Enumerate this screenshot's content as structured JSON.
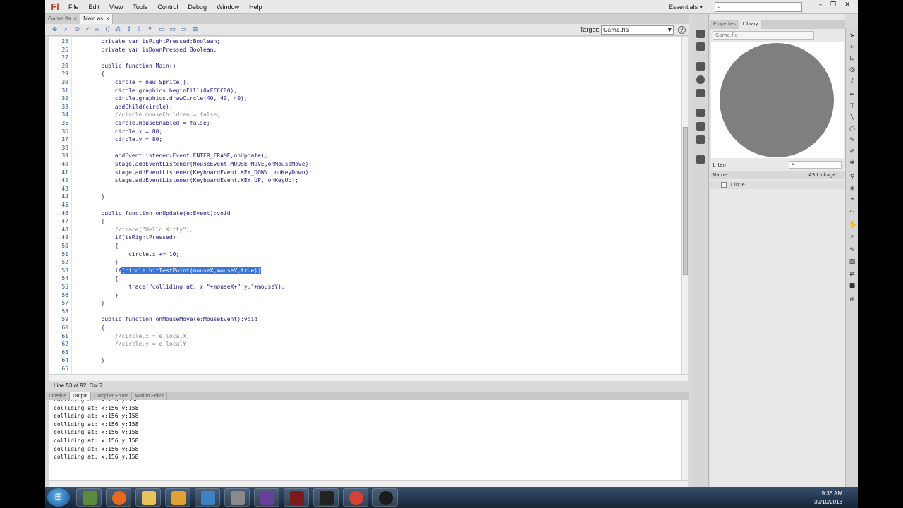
{
  "app": {
    "logo": "Fl"
  },
  "menu": [
    "File",
    "Edit",
    "View",
    "Tools",
    "Control",
    "Debug",
    "Window",
    "Help"
  ],
  "workspace": {
    "label": "Essentials ▾"
  },
  "tabs": [
    {
      "label": "Game.fla",
      "close": "×"
    },
    {
      "label": "Main.as",
      "close": "×"
    }
  ],
  "target": {
    "label": "Target:",
    "value": "Game.fla"
  },
  "code": {
    "lines": [
      {
        "n": "25",
        "t": "        private var isRightPressed:Boolean;"
      },
      {
        "n": "26",
        "t": "        private var isDownPressed:Boolean;"
      },
      {
        "n": "27",
        "t": ""
      },
      {
        "n": "28",
        "t": "        public function Main()"
      },
      {
        "n": "29",
        "t": "        {"
      },
      {
        "n": "30",
        "t": "            circle = new Sprite();"
      },
      {
        "n": "31",
        "t": "            circle.graphics.beginFill(0xFFCC00);"
      },
      {
        "n": "32",
        "t": "            circle.graphics.drawCircle(40, 40, 40);"
      },
      {
        "n": "33",
        "t": "            addChild(circle);"
      },
      {
        "n": "34",
        "t": "            //circle.mouseChildren = false;"
      },
      {
        "n": "35",
        "t": "            circle.mouseEnabled = false;"
      },
      {
        "n": "36",
        "t": "            circle.x = 80;"
      },
      {
        "n": "37",
        "t": "            circle.y = 80;"
      },
      {
        "n": "38",
        "t": ""
      },
      {
        "n": "39",
        "t": "            addEventListener(Event.ENTER_FRAME,onUpdate);"
      },
      {
        "n": "40",
        "t": "            stage.addEventListener(MouseEvent.MOUSE_MOVE,onMouseMove);"
      },
      {
        "n": "41",
        "t": "            stage.addEventListener(KeyboardEvent.KEY_DOWN, onKeyDown);"
      },
      {
        "n": "42",
        "t": "            stage.addEventListener(KeyboardEvent.KEY_UP, onKeyUp);"
      },
      {
        "n": "43",
        "t": ""
      },
      {
        "n": "44",
        "t": "        }"
      },
      {
        "n": "45",
        "t": ""
      },
      {
        "n": "46",
        "t": "        public function onUpdate(e:Event):void"
      },
      {
        "n": "47",
        "t": "        {"
      },
      {
        "n": "48",
        "t": "            //trace(\"Hello Kitty\");"
      },
      {
        "n": "49",
        "t": "            if(isRightPressed)"
      },
      {
        "n": "50",
        "t": "            {"
      },
      {
        "n": "51",
        "t": "                circle.x += 10;"
      },
      {
        "n": "52",
        "t": "            }"
      },
      {
        "n": "53",
        "t": "            if(circle.hitTestPoint(mouseX,mouseY,true))"
      },
      {
        "n": "54",
        "t": "            {"
      },
      {
        "n": "55",
        "t": "                trace(\"colliding at: x:\"+mouseX+\" y:\"+mouseY);"
      },
      {
        "n": "56",
        "t": "            }"
      },
      {
        "n": "57",
        "t": "        }"
      },
      {
        "n": "58",
        "t": ""
      },
      {
        "n": "59",
        "t": "        public function onMouseMove(e:MouseEvent):void"
      },
      {
        "n": "60",
        "t": "        {"
      },
      {
        "n": "61",
        "t": "            //circle.x = e.localX;"
      },
      {
        "n": "62",
        "t": "            //circle.y = e.localY;"
      },
      {
        "n": "63",
        "t": ""
      },
      {
        "n": "64",
        "t": "        }"
      },
      {
        "n": "65",
        "t": ""
      }
    ]
  },
  "status": "Line 53 of 92, Col 7",
  "panel_tabs": [
    "Timeline",
    "Output",
    "Compiler Errors",
    "Motion Editor"
  ],
  "output": [
    "colliding at: x:156 y:158",
    "colliding at: x:156 y:158",
    "colliding at: x:156 y:158",
    "colliding at: x:156 y:158",
    "colliding at: x:156 y:158",
    "colliding at: x:156 y:158",
    "colliding at: x:156 y:158",
    "colliding at: x:156 y:158"
  ],
  "library": {
    "tabs": [
      "Properties",
      "Library"
    ],
    "doc": "Game.fla",
    "count": "1 item",
    "col_name": "Name",
    "col_linkage": "AS Linkage",
    "items": [
      {
        "name": "Circle"
      }
    ],
    "preview_color": "#7f7f7f"
  },
  "clock": {
    "time": "9:36 AM",
    "date": "30/10/2013"
  }
}
